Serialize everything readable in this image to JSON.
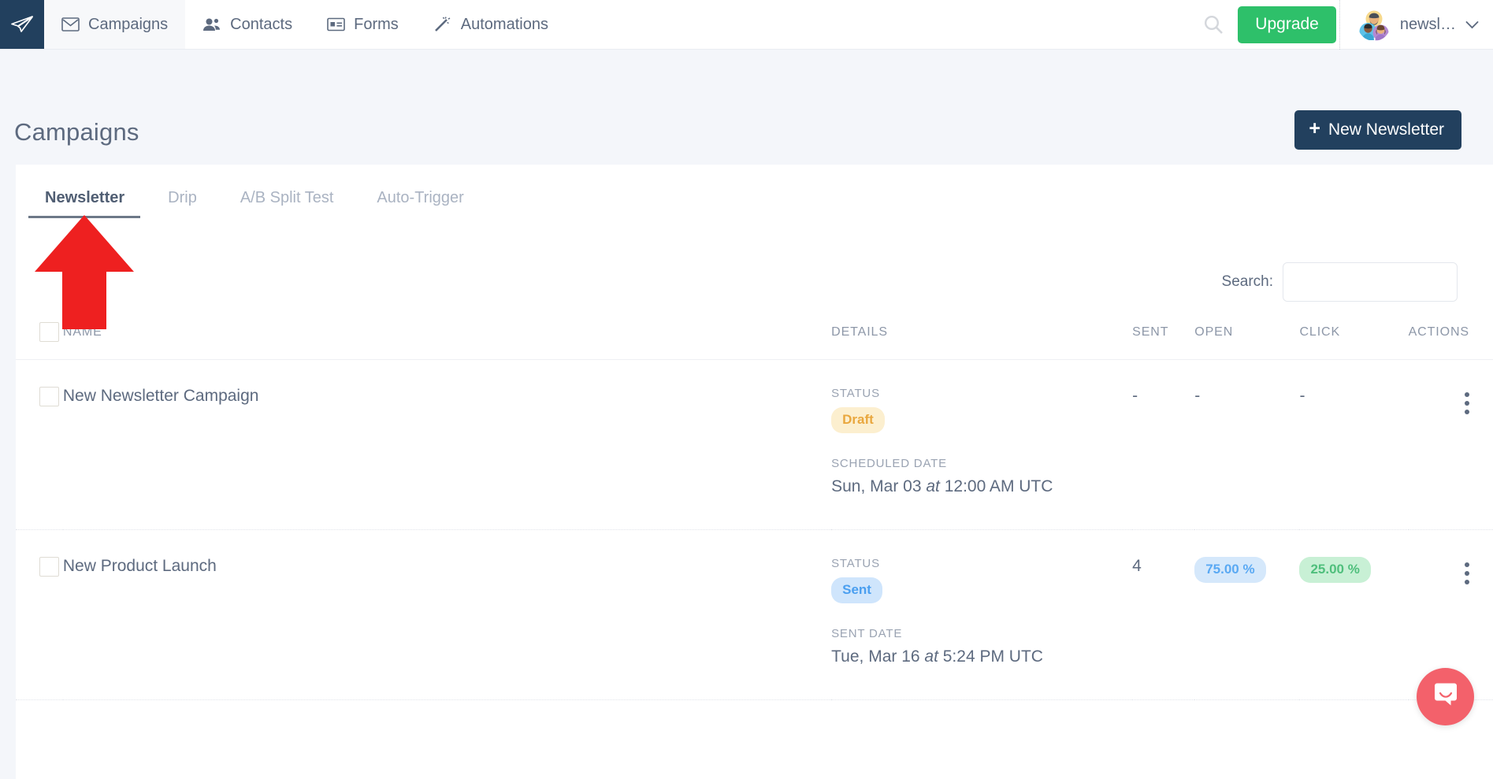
{
  "topnav": {
    "logo_icon": "paper-plane-icon",
    "items": [
      {
        "label": "Campaigns",
        "icon": "envelope-icon",
        "active": true
      },
      {
        "label": "Contacts",
        "icon": "people-icon",
        "active": false
      },
      {
        "label": "Forms",
        "icon": "form-icon",
        "active": false
      },
      {
        "label": "Automations",
        "icon": "magic-wand-icon",
        "active": false
      }
    ],
    "search_icon": "search-icon",
    "upgrade_label": "Upgrade",
    "upgrade_color": "#2ec06a",
    "account_name": "newsl…",
    "account_avatar": "avatar-people-icon",
    "account_chevron": "chevron-down-icon"
  },
  "page": {
    "title": "Campaigns",
    "new_button_label": "New Newsletter",
    "new_button_icon": "plus-icon",
    "new_button_color": "#22405e"
  },
  "tabs": [
    {
      "label": "Newsletter",
      "active": true
    },
    {
      "label": "Drip",
      "active": false
    },
    {
      "label": "A/B Split Test",
      "active": false
    },
    {
      "label": "Auto-Trigger",
      "active": false
    }
  ],
  "search": {
    "label": "Search:",
    "value": "",
    "placeholder": ""
  },
  "table": {
    "columns": [
      "",
      "NAME",
      "DETAILS",
      "SENT",
      "OPEN",
      "CLICK",
      "ACTIONS"
    ],
    "select_all_checked": false,
    "rows": [
      {
        "checked": false,
        "name": "New Newsletter Campaign",
        "status_label": "STATUS",
        "status_value": "Draft",
        "status_kind": "draft",
        "date_label": "SCHEDULED DATE",
        "date_value_prefix": "Sun, Mar 03 ",
        "date_value_italic": "at",
        "date_value_suffix": " 12:00 AM UTC",
        "sent": "-",
        "open": "-",
        "open_is_badge": false,
        "click": "-",
        "click_is_badge": false,
        "actions_icon": "kebab-menu-icon"
      },
      {
        "checked": false,
        "name": "New Product Launch",
        "status_label": "STATUS",
        "status_value": "Sent",
        "status_kind": "sent",
        "date_label": "SENT DATE",
        "date_value_prefix": "Tue, Mar 16 ",
        "date_value_italic": "at",
        "date_value_suffix": " 5:24 PM UTC",
        "sent": "4",
        "open": "75.00 %",
        "open_is_badge": true,
        "click": "25.00 %",
        "click_is_badge": true,
        "actions_icon": "kebab-menu-icon"
      }
    ]
  },
  "annotation": {
    "type": "up-arrow",
    "color": "#ee2020",
    "points_at": "Newsletter tab"
  },
  "intercom": {
    "icon": "chat-bubble-icon",
    "color": "#f3616b"
  }
}
